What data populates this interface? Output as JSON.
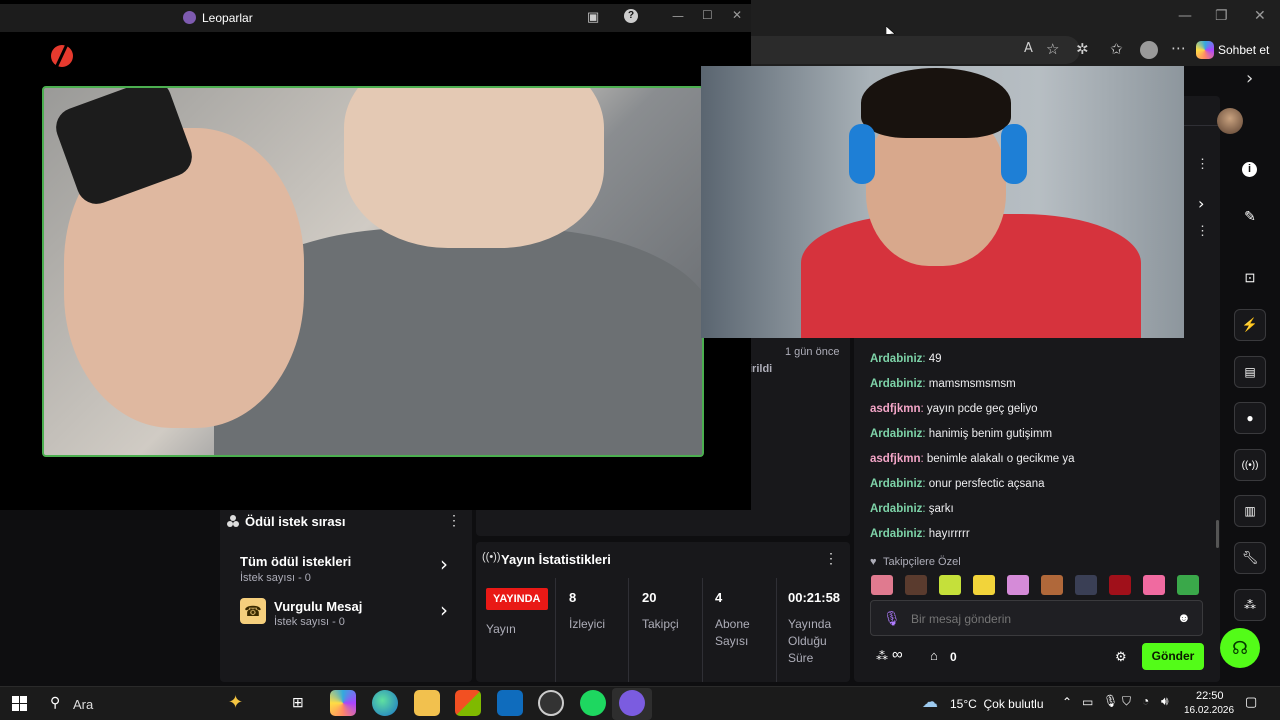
{
  "video_window": {
    "title": "Leoparlar",
    "controls": {
      "minimize": "—",
      "maximize": "☐",
      "close": "✕"
    }
  },
  "browser": {
    "copilot_label": "Sohbet et",
    "window_controls": {
      "minimize": "—",
      "restore": "❐",
      "close": "✕"
    }
  },
  "reward_queue": {
    "title": "Ödül istek sırası",
    "items": [
      {
        "title": "Tüm ödül istekleri",
        "subtitle": "İstek sayısı - 0"
      },
      {
        "title": "Vurgulu Mesaj",
        "subtitle": "İstek sayısı - 0"
      }
    ]
  },
  "activity": {
    "time": "1 gün önce",
    "snippet": "irildi"
  },
  "stream_stats": {
    "title": "Yayın İstatistikleri",
    "live_badge": "YAYINDA",
    "live_label": "Yayın",
    "stats": [
      {
        "value": "8",
        "label": "İzleyici"
      },
      {
        "value": "20",
        "label": "Takipçi"
      },
      {
        "value": "4",
        "label": "Abone Sayısı"
      },
      {
        "value": "00:21:58",
        "label": "Yayında Olduğu Süre"
      }
    ]
  },
  "chat": {
    "messages": [
      {
        "user": "Ardabiniz",
        "color": "#7dd3a8",
        "text": "49"
      },
      {
        "user": "Ardabiniz",
        "color": "#7dd3a8",
        "text": "mamsmsmsmsm"
      },
      {
        "user": "asdfjkmn",
        "color": "#f4a6c8",
        "text": "yayın pcde geç geliyo"
      },
      {
        "user": "Ardabiniz",
        "color": "#7dd3a8",
        "text": "hanimiş benim gutişimm"
      },
      {
        "user": "asdfjkmn",
        "color": "#f4a6c8",
        "text": "benimle alakalı o gecikme ya"
      },
      {
        "user": "Ardabiniz",
        "color": "#7dd3a8",
        "text": "onur persfectic açsana"
      },
      {
        "user": "Ardabiniz",
        "color": "#7dd3a8",
        "text": "şarkı"
      },
      {
        "user": "Ardabiniz",
        "color": "#7dd3a8",
        "text": "hayırrrrr"
      }
    ],
    "emote_section": "Takipçilere Özel",
    "emote_colors": [
      "#e07a8f",
      "#5a3b2e",
      "#c5e03a",
      "#f2d43a",
      "#d58bd8",
      "#b0683a",
      "#3a3f55",
      "#a0101a",
      "#f06aa0",
      "#3aa84a"
    ],
    "input_placeholder": "Bir mesaj gönderin",
    "points_value": "∞",
    "gift_value": "0",
    "send_label": "Gönder"
  },
  "taskbar": {
    "search_label": "Ara",
    "weather": "15°C  Çok bulutlu",
    "time": "22:50",
    "date": "16.02.2026"
  },
  "colors": {
    "accent": "#53fc18",
    "live": "#e91916",
    "kick_red": "#e63a2e"
  }
}
